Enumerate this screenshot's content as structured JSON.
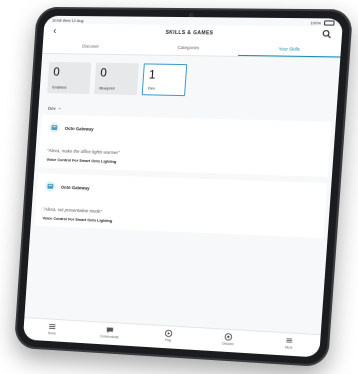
{
  "status": {
    "time": "10:08",
    "date": "Wed 12 Aug",
    "battery": "100%"
  },
  "header": {
    "title": "SKILLS & GAMES"
  },
  "tabs": [
    {
      "label": "Discover",
      "active": false
    },
    {
      "label": "Categories",
      "active": false
    },
    {
      "label": "Your Skills",
      "active": true
    }
  ],
  "stats": [
    {
      "count": "0",
      "label": "Enabled",
      "active": false
    },
    {
      "count": "0",
      "label": "Blueprint",
      "active": false
    },
    {
      "count": "1",
      "label": "Dev",
      "active": true
    }
  ],
  "filter": {
    "label": "Dev"
  },
  "cards": [
    {
      "device": "Octo Gateway",
      "utterance": "\"Alexa, make the office lights warmer\"",
      "skill": "Voice Control For Smart Octo Lighting"
    },
    {
      "device": "Octo Gateway",
      "utterance": "\"Alexa, set presentation mode\"",
      "skill": "Voice Control For Smart Octo Lighting"
    }
  ],
  "nav": [
    {
      "label": "Home",
      "icon": "home-icon"
    },
    {
      "label": "Communicate",
      "icon": "chat-icon"
    },
    {
      "label": "Play",
      "icon": "play-icon"
    },
    {
      "label": "Devices",
      "icon": "devices-icon"
    },
    {
      "label": "More",
      "icon": "menu-icon"
    }
  ],
  "colors": {
    "accent": "#1a8cb0",
    "card_border": "#3b98c9",
    "bezel": "#1b1c1f",
    "screen_bg": "#f7f8f9"
  }
}
